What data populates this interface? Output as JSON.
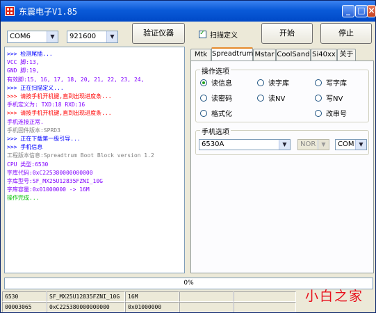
{
  "window": {
    "title": "东震电子V1.85",
    "min_glyph": "_",
    "max_glyph": "□",
    "close_glyph": "×"
  },
  "toolbar": {
    "port": "COM6",
    "baud": "921600",
    "verify_label": "验证仪器",
    "scan_label": "扫描定义",
    "scan_checked": true,
    "start_label": "开始",
    "stop_label": "停止"
  },
  "log": [
    {
      "text": ">>> 检测尾插...",
      "color": "#0000ff"
    },
    {
      "text": "    VCC 脚:13,",
      "color": "#8000ff"
    },
    {
      "text": "    GND 脚:19,",
      "color": "#8000ff"
    },
    {
      "text": "    有效脚:15, 16, 17, 18, 20, 21, 22, 23, 24,",
      "color": "#8000ff"
    },
    {
      "text": ">>> 正在扫描定义...",
      "color": "#0000ff"
    },
    {
      "text": ">>> 请按手机开机键,直到出现进度条...",
      "color": "#ff0000"
    },
    {
      "text": "    手机定义为: TXD:18  RXD:16",
      "color": "#8000ff"
    },
    {
      "text": ">>> 请按手机开机键,直到出现进度条...",
      "color": "#ff0000"
    },
    {
      "text": "    手机连接正常.",
      "color": "#8000ff"
    },
    {
      "text": "    手机固件版本:SPRD3",
      "color": "#808080"
    },
    {
      "text": ">>> 正在下载第一级引导...",
      "color": "#0000ff"
    },
    {
      "text": ">>> 手机信息",
      "color": "#0000ff"
    },
    {
      "text": "    工程版本信息:Spreadtrum Boot Block version 1.2",
      "color": "#808080"
    },
    {
      "text": "    CPU 类型:6530",
      "color": "#8000ff"
    },
    {
      "text": "    字库代码:0xC225380000000000",
      "color": "#8000ff"
    },
    {
      "text": "    字库型号:SF_MX25U12835FZNI_10G",
      "color": "#8000ff"
    },
    {
      "text": "    字库容量:0x01000000  -> 16M",
      "color": "#8000ff"
    },
    {
      "text": "    操作完成...",
      "color": "#00c000"
    }
  ],
  "tabs": [
    "Mtk",
    "Spreadtrum",
    "Mstar",
    "CoolSand",
    "Si40xx",
    "关于"
  ],
  "active_tab": "Spreadtrum",
  "operations": {
    "title": "操作选项",
    "options": [
      {
        "label": "读信息",
        "checked": true
      },
      {
        "label": "读字库",
        "checked": false
      },
      {
        "label": "写字库",
        "checked": false
      },
      {
        "label": "读密码",
        "checked": false
      },
      {
        "label": "读NV",
        "checked": false
      },
      {
        "label": "写NV",
        "checked": false
      },
      {
        "label": "格式化",
        "checked": false
      },
      {
        "label": "改串号",
        "checked": false
      }
    ]
  },
  "phone": {
    "title": "手机选项",
    "model": "6530A",
    "flash": "NOR",
    "port": "COM"
  },
  "progress": {
    "label": "0%",
    "value": 0
  },
  "statusbar": {
    "row1": [
      "6530",
      "SF_MX25U12835FZNI_10G",
      "16M",
      "",
      ""
    ],
    "row2": [
      "00003065",
      "0xC225380000000000",
      "0x01000000",
      "",
      ""
    ]
  },
  "watermark": "小白之家",
  "colors": {
    "titlebar": "#0a5ad8",
    "tab_accent": "#e68b2c",
    "watermark": "#e8101c"
  }
}
